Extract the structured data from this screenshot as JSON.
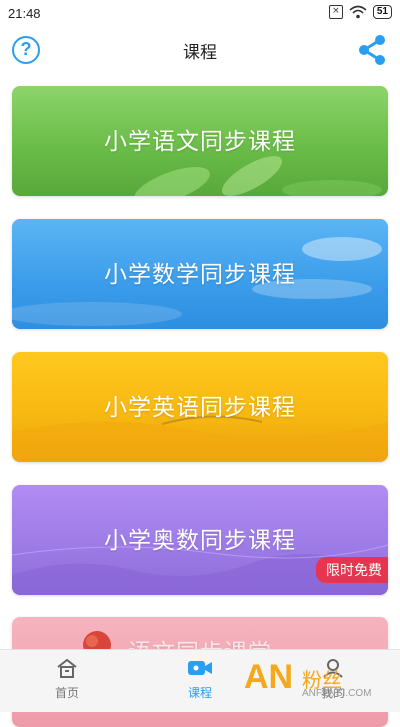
{
  "status_bar": {
    "time": "21:48",
    "battery": "51"
  },
  "header": {
    "title": "课程",
    "help_glyph": "?"
  },
  "courses": [
    {
      "label": "小学语文同步课程"
    },
    {
      "label": "小学数学同步课程"
    },
    {
      "label": "小学英语同步课程"
    },
    {
      "label": "小学奥数同步课程",
      "badge": "限时免费"
    },
    {
      "label": "语文同步课堂"
    }
  ],
  "tabbar": {
    "items": [
      {
        "label": "首页",
        "icon": "home-icon",
        "active": false
      },
      {
        "label": "课程",
        "icon": "video-icon",
        "active": true
      },
      {
        "label": "我的",
        "icon": "user-icon",
        "active": false
      }
    ],
    "active_color": "#2a9ef0"
  },
  "watermark": {
    "brand": "AN",
    "text": "粉丝",
    "url": "ANFENSI.COM"
  },
  "colors": {
    "accent": "#2a9ef0",
    "badge": "#e8354f"
  }
}
